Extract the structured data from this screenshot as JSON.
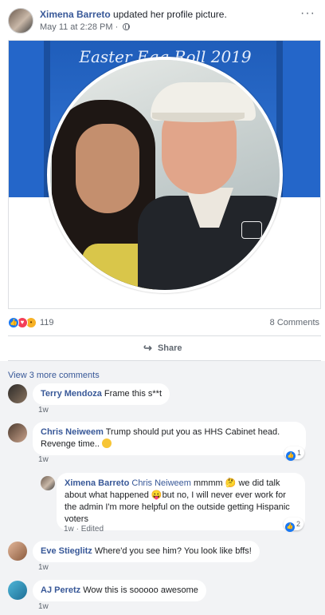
{
  "post": {
    "author": "Ximena Barreto",
    "action": "updated her profile picture.",
    "timestamp": "May 11 at 2:28 PM",
    "separator": "·",
    "privacy_icon": "globe-icon",
    "more_icon": "ellipsis-icon"
  },
  "photo": {
    "cover_text": "Easter Egg Roll 2019"
  },
  "reactions": {
    "icons": [
      "like-icon",
      "love-icon",
      "wow-icon"
    ],
    "count": "119",
    "comments_link": "8 Comments"
  },
  "actions": {
    "share_label": "Share",
    "share_icon": "share-arrow-icon"
  },
  "comments": {
    "view_more": "View 3 more comments",
    "items": [
      {
        "name": "Terry Mendoza",
        "text": "Frame this s**t",
        "time": "1w"
      },
      {
        "name": "Chris Neiweem",
        "text": "Trump should put you as HHS Cabinet head. Revenge time..",
        "time": "1w",
        "likes": "1"
      },
      {
        "name": "Ximena Barreto",
        "mention": "Chris Neiweem",
        "text": "mmmm 🤔 we did talk about what happened 😛but no, I will never ever work for the admin I'm more helpful on the outside getting Hispanic voters",
        "time": "1w",
        "edited": "Edited",
        "likes": "2"
      },
      {
        "name": "Eve Stieglitz",
        "text": "Where'd you see him? You look like bffs!",
        "time": "1w"
      },
      {
        "name": "AJ Peretz",
        "text": "Wow this is sooooo awesome",
        "time": "1w"
      }
    ]
  },
  "colors": {
    "link": "#385898",
    "like_blue": "#1877f2",
    "comment_bg": "#f2f3f5"
  }
}
